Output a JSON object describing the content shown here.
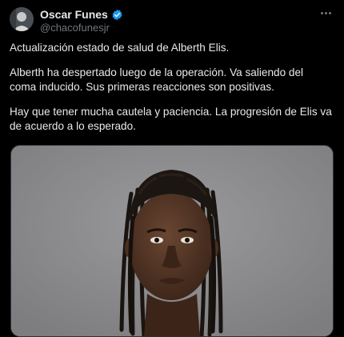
{
  "author": {
    "display_name": "Oscar Funes",
    "handle": "@chacofunesjr",
    "verified_icon": "verified-badge-icon",
    "badge_color": "#1d9bf0"
  },
  "tweet": {
    "paragraphs": [
      "Actualización estado de salud de Alberth Elis.",
      "Alberth ha despertado luego de la operación. Va saliendo del coma inducido. Sus primeras reacciones son positivas.",
      "Hay que tener mucha cautela y paciencia. La progresión de Elis va de acuerdo a lo esperado."
    ]
  },
  "media": {
    "kind": "portrait-photo",
    "background_color": "#868689"
  },
  "menu": {
    "icon": "more-options-icon"
  },
  "theme": {
    "background": "#000000",
    "text": "#e7e9ea",
    "secondary_text": "#71767b"
  }
}
